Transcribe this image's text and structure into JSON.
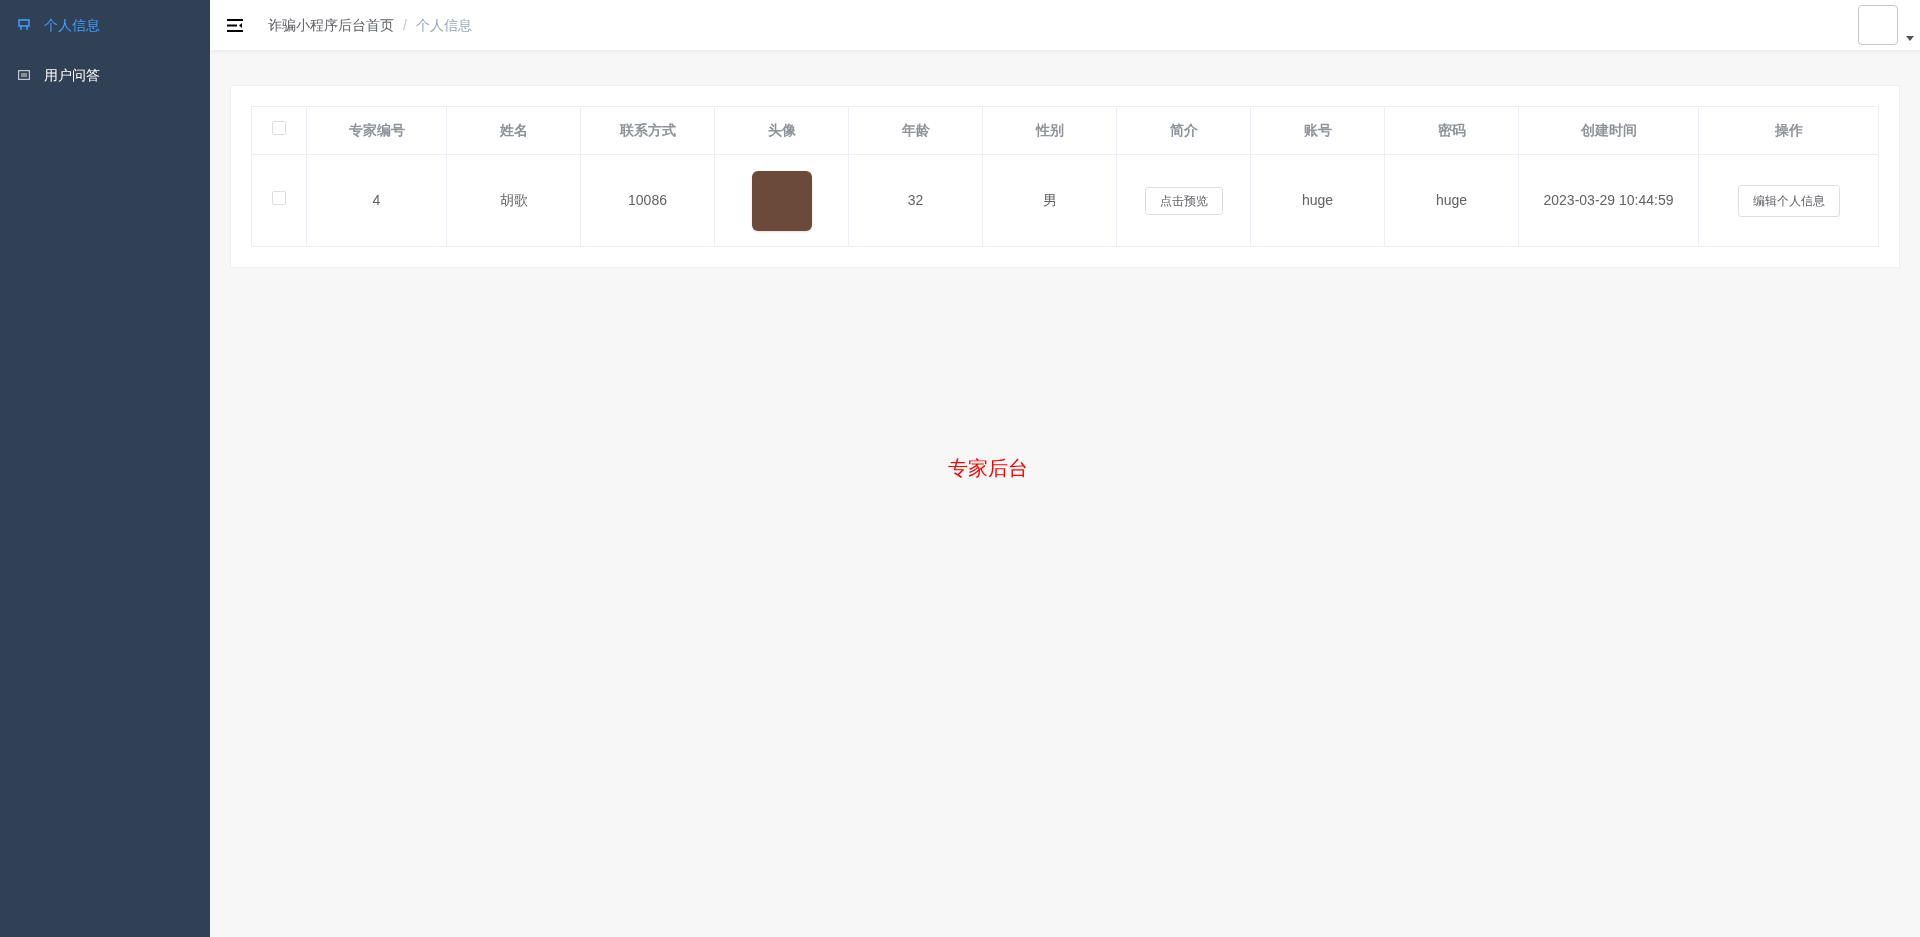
{
  "sidebar": {
    "items": [
      {
        "label": "个人信息",
        "selected": true,
        "kind": "monitor"
      },
      {
        "label": "用户问答",
        "selected": false,
        "kind": "panel"
      }
    ]
  },
  "breadcrumb": [
    "诈骗小程序后台首页",
    "个人信息"
  ],
  "breadcrumb_separator": "/",
  "table": {
    "header_checked": false,
    "columns": [
      "专家编号",
      "姓名",
      "联系方式",
      "头像",
      "年龄",
      "性别",
      "简介",
      "账号",
      "密码",
      "创建时间",
      "操作"
    ],
    "rows": [
      {
        "checked": false,
        "id": "4",
        "name": "胡歌",
        "contact": "10086",
        "age": "32",
        "gender": "男",
        "intro_button": "点击预览",
        "account": "huge",
        "password": "huge",
        "created": "2023-03-29 10:44:59",
        "action_button": "编辑个人信息"
      }
    ]
  },
  "center_text": "专家后台"
}
